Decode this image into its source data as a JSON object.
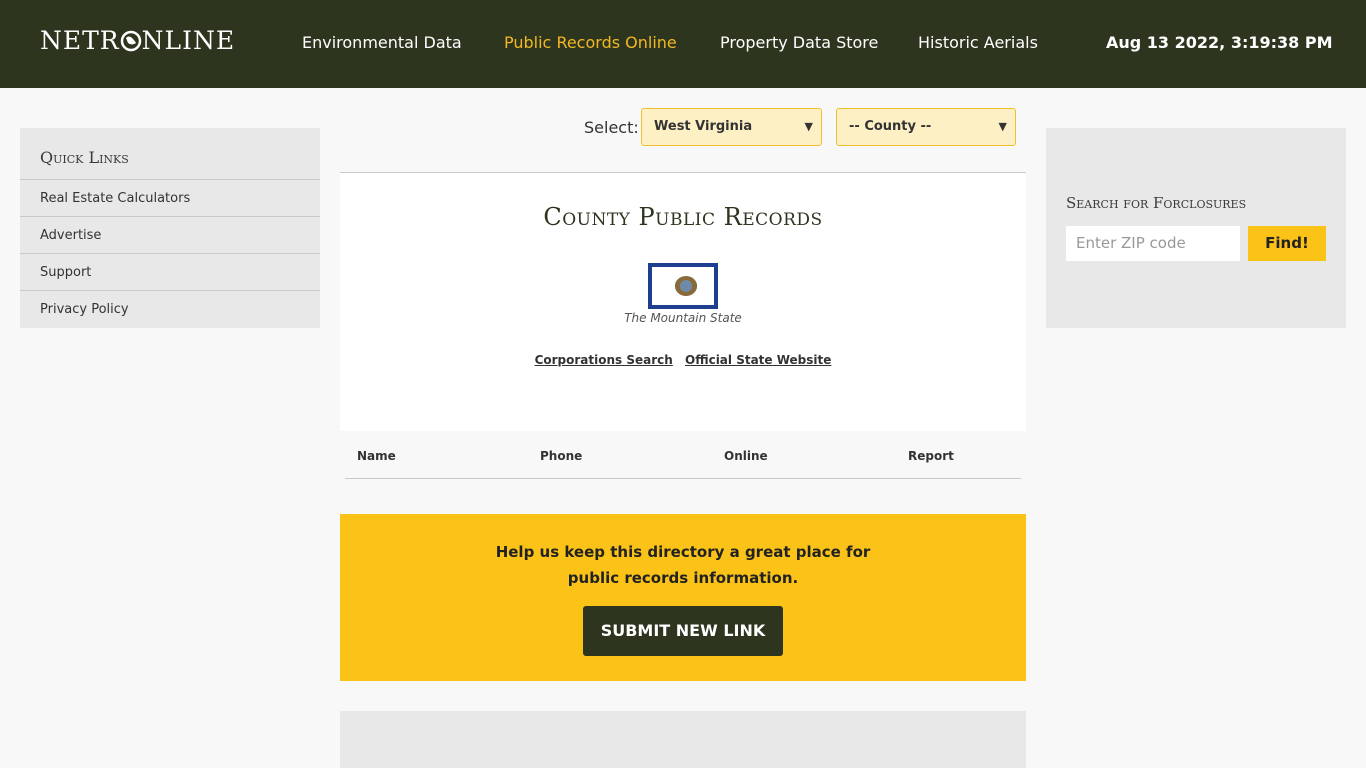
{
  "header": {
    "logo_text_left": "NETR",
    "logo_text_right": "NLINE",
    "nav": [
      {
        "label": "Environmental Data",
        "active": false
      },
      {
        "label": "Public Records Online",
        "active": true
      },
      {
        "label": "Property Data Store",
        "active": false
      },
      {
        "label": "Historic Aerials",
        "active": false
      }
    ],
    "datetime": "Aug 13 2022, 3:19:38 PM"
  },
  "quick_links": {
    "title": "Quick Links",
    "items": [
      "Real Estate Calculators",
      "Advertise",
      "Support",
      "Privacy Policy"
    ]
  },
  "selector": {
    "label": "Select:",
    "state": "West Virginia",
    "county": "-- County --"
  },
  "main": {
    "title": "County Public Records",
    "motto": "The Mountain State",
    "links": [
      "Corporations Search",
      "Official State Website"
    ],
    "columns": [
      "Name",
      "Phone",
      "Online",
      "Report"
    ]
  },
  "cta": {
    "line1": "Help us keep this directory a great place for",
    "line2": "public records information.",
    "button": "SUBMIT NEW LINK"
  },
  "foreclosure": {
    "title": "Search for Forclosures",
    "placeholder": "Enter ZIP code",
    "button": "Find!"
  },
  "colors": {
    "header_bg": "#2d351f",
    "accent": "#fbc318",
    "active_nav": "#f2b824",
    "flag_blue": "#1e3f8f"
  }
}
